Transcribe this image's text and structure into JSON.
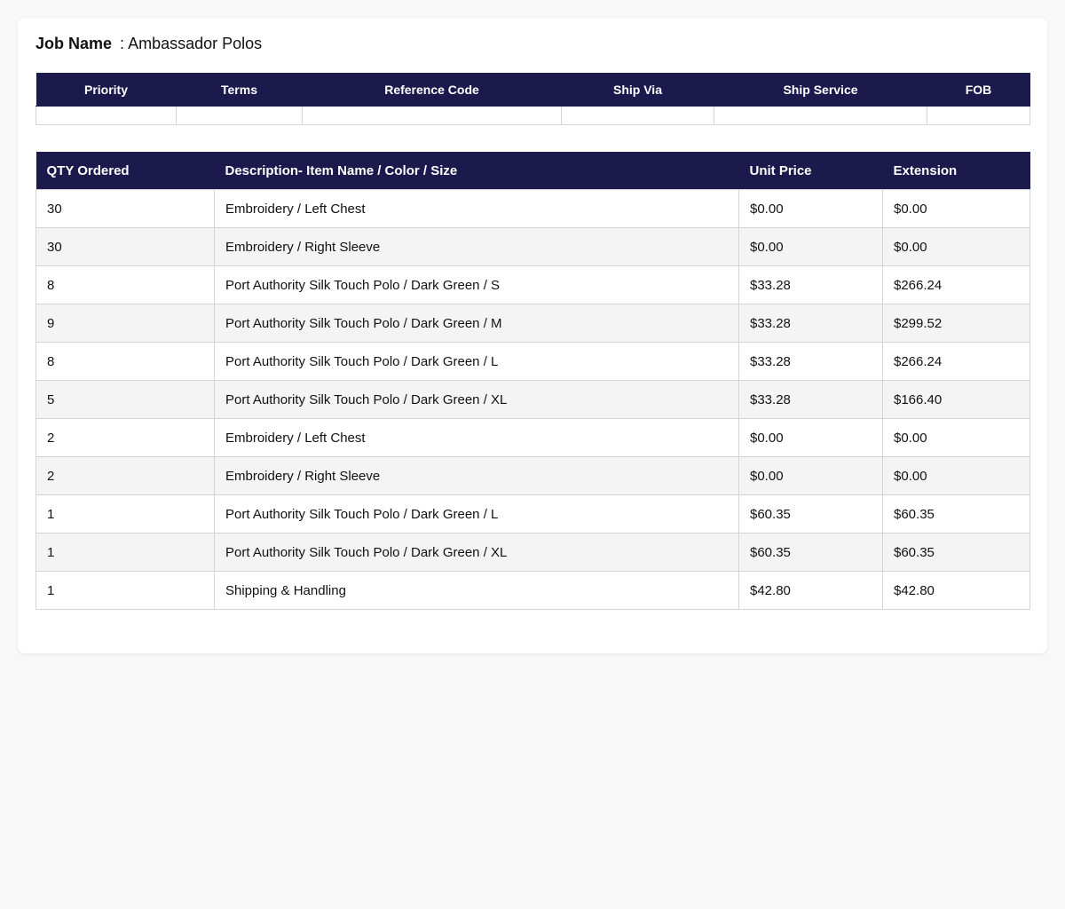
{
  "job": {
    "label": "Job Name",
    "separator": ":",
    "value": "Ambassador Polos"
  },
  "meta_table": {
    "headers": [
      "Priority",
      "Terms",
      "Reference Code",
      "Ship Via",
      "Ship Service",
      "FOB"
    ],
    "values": [
      "",
      "",
      "",
      "",
      "",
      ""
    ]
  },
  "items_table": {
    "headers": [
      "QTY Ordered",
      "Description- Item Name / Color / Size",
      "Unit Price",
      "Extension"
    ],
    "rows": [
      {
        "qty": "30",
        "description": "Embroidery / Left Chest",
        "unit_price": "$0.00",
        "extension": "$0.00"
      },
      {
        "qty": "30",
        "description": "Embroidery / Right Sleeve",
        "unit_price": "$0.00",
        "extension": "$0.00"
      },
      {
        "qty": "8",
        "description": "Port Authority Silk Touch Polo / Dark Green / S",
        "unit_price": "$33.28",
        "extension": "$266.24"
      },
      {
        "qty": "9",
        "description": "Port Authority Silk Touch Polo / Dark Green / M",
        "unit_price": "$33.28",
        "extension": "$299.52"
      },
      {
        "qty": "8",
        "description": "Port Authority Silk Touch Polo / Dark Green / L",
        "unit_price": "$33.28",
        "extension": "$266.24"
      },
      {
        "qty": "5",
        "description": "Port Authority Silk Touch Polo / Dark Green / XL",
        "unit_price": "$33.28",
        "extension": "$166.40"
      },
      {
        "qty": "2",
        "description": "Embroidery / Left Chest",
        "unit_price": "$0.00",
        "extension": "$0.00"
      },
      {
        "qty": "2",
        "description": "Embroidery / Right Sleeve",
        "unit_price": "$0.00",
        "extension": "$0.00"
      },
      {
        "qty": "1",
        "description": "Port Authority Silk Touch Polo / Dark Green / L",
        "unit_price": "$60.35",
        "extension": "$60.35"
      },
      {
        "qty": "1",
        "description": "Port Authority Silk Touch Polo / Dark Green / XL",
        "unit_price": "$60.35",
        "extension": "$60.35"
      },
      {
        "qty": "1",
        "description": "Shipping & Handling",
        "unit_price": "$42.80",
        "extension": "$42.80"
      }
    ]
  },
  "colors": {
    "header_bg": "#1c1a4d",
    "header_text": "#ffffff",
    "row_alt_bg": "#f4f4f4",
    "border": "#d4d4d4"
  }
}
